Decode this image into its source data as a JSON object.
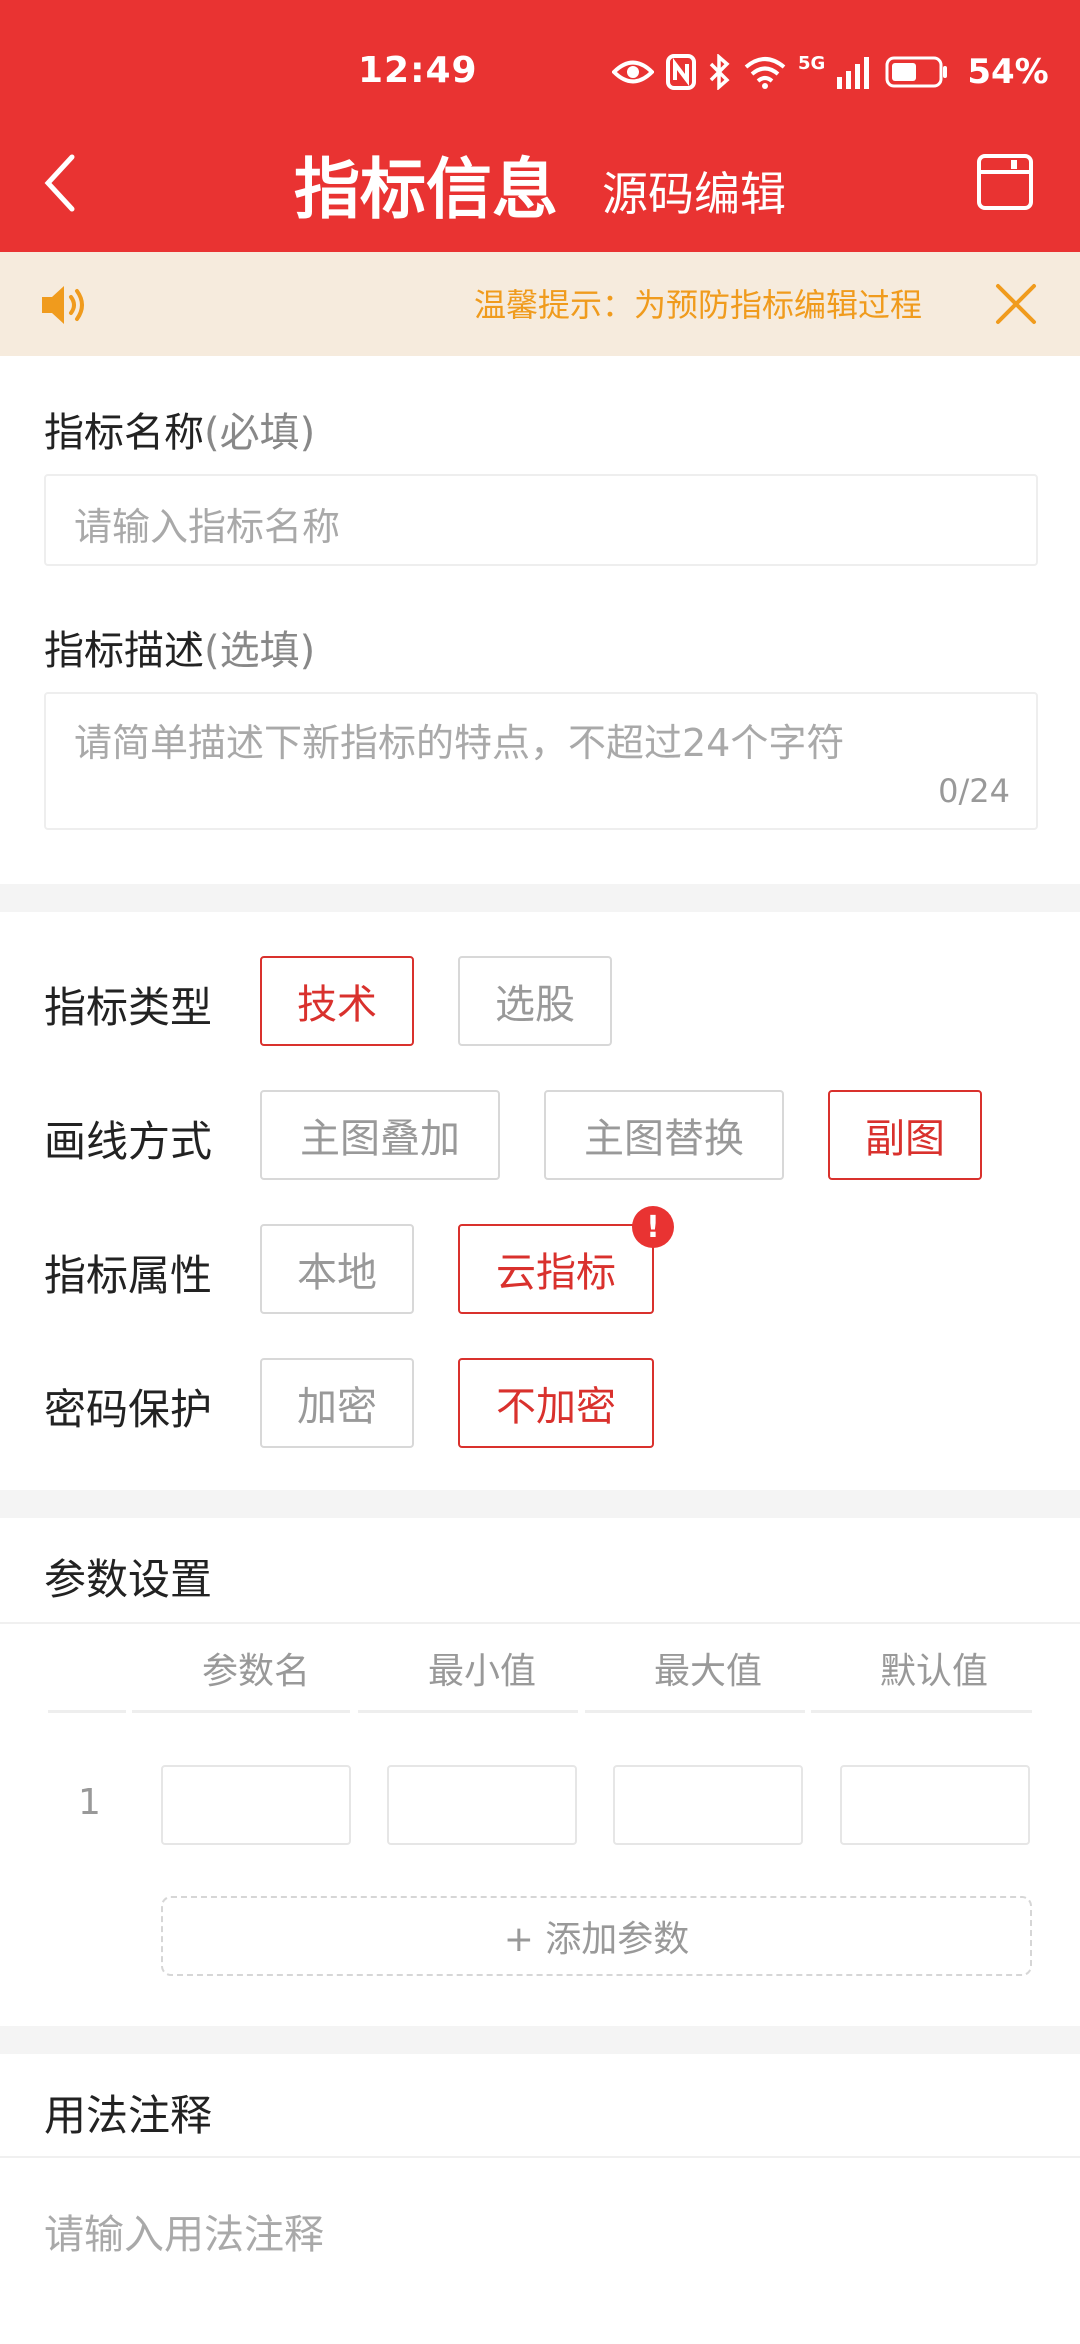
{
  "status_bar": {
    "time": "12:49",
    "network": "5G",
    "battery_percent": "54%",
    "battery_level": 0.54,
    "icons": [
      "eye-icon",
      "nfc-icon",
      "bluetooth-icon",
      "wifi-icon",
      "signal-icon",
      "battery-icon"
    ]
  },
  "header": {
    "title": "指标信息",
    "tab_source_edit": "源码编辑",
    "back_icon": "chevron-left-icon",
    "save_icon": "save-icon"
  },
  "notice": {
    "text": "温馨提示：为预防指标编辑过程",
    "speaker_icon": "speaker-icon",
    "close_icon": "close-icon"
  },
  "form": {
    "name_label": "指标名称",
    "name_hint": "(必填)",
    "name_placeholder": "请输入指标名称",
    "desc_label": "指标描述",
    "desc_hint": "(选填)",
    "desc_placeholder": "请简单描述下新指标的特点，不超过24个字符",
    "desc_counter": "0/24"
  },
  "options": {
    "type": {
      "label": "指标类型",
      "choices": [
        "技术",
        "选股"
      ],
      "selected": "技术"
    },
    "draw": {
      "label": "画线方式",
      "choices": [
        "主图叠加",
        "主图替换",
        "副图"
      ],
      "selected": "副图"
    },
    "attr": {
      "label": "指标属性",
      "choices": [
        "本地",
        "云指标"
      ],
      "selected": "云指标",
      "badge": "!"
    },
    "password": {
      "label": "密码保护",
      "choices": [
        "加密",
        "不加密"
      ],
      "selected": "不加密"
    }
  },
  "params": {
    "title": "参数设置",
    "columns": [
      "参数名",
      "最小值",
      "最大值",
      "默认值"
    ],
    "rows": [
      {
        "index": "1",
        "name": "",
        "min": "",
        "max": "",
        "default": ""
      }
    ],
    "add_label": "+ 添加参数"
  },
  "usage": {
    "title": "用法注释",
    "placeholder": "请输入用法注释"
  },
  "colors": {
    "brand_red": "#e93332",
    "selected_red": "#d9312d",
    "notice_bg": "#f6ebdd",
    "notice_text": "#f09b1d"
  }
}
